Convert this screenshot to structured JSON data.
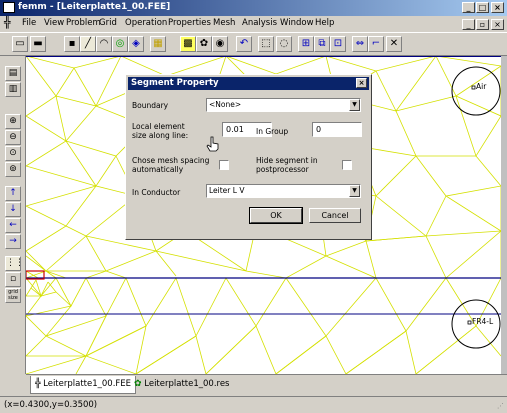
{
  "window": {
    "title": "femm - [Leiterplatte1_00.FEE]",
    "minimize": "_",
    "maximize": "□",
    "close": "×",
    "doc_minimize": "_",
    "doc_restore": "▫",
    "doc_close": "×"
  },
  "menu": [
    "File",
    "View",
    "Problem",
    "Grid",
    "Operation",
    "Properties",
    "Mesh",
    "Analysis",
    "Window",
    "Help"
  ],
  "canvas": {
    "labels": [
      "Air",
      "FR4-L"
    ],
    "colors": {
      "mesh": "#d4e000",
      "boundary": "#000080",
      "segment": "#cc0000"
    }
  },
  "dialog": {
    "title": "Segment Property",
    "close": "×",
    "boundary_label": "Boundary",
    "boundary_value": "<None>",
    "elem_size_label_1": "Local element",
    "elem_size_label_2": "size along line:",
    "elem_size_value": "0.01",
    "in_group_label": "In Group",
    "in_group_value": "0",
    "chose_mesh_label_1": "Chose mesh spacing",
    "chose_mesh_label_2": "automatically",
    "hide_segment_label_1": "Hide segment in",
    "hide_segment_label_2": "postprocessor",
    "in_conductor_label": "In Conductor",
    "in_conductor_value": "Leiter L V",
    "ok_label": "OK",
    "cancel_label": "Cancel"
  },
  "tabs": [
    "Leiterplatte1_00.FEE",
    "Leiterplatte1_00.res"
  ],
  "left_toolbar": {
    "grid_size_label": "grid size"
  },
  "status": {
    "coordinates": "(x=0.4300,y=0.3500)"
  }
}
